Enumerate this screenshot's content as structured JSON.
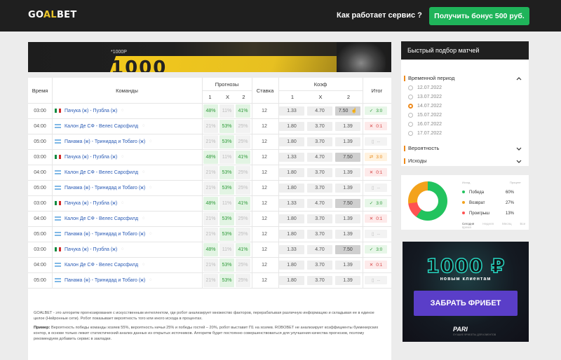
{
  "header": {
    "logo_prefix": "GO",
    "logo_accent": "AL",
    "logo_suffix": "BET",
    "how_it_works": "Как работает сервис ?",
    "bonus_button": "Получить бонус 500 руб."
  },
  "banner": {
    "small_text": "*1000Р",
    "big_text": "1000"
  },
  "table": {
    "headers": {
      "time": "Время",
      "teams": "Команды",
      "forecasts": "Прогнозы",
      "stake": "Ставка",
      "coef": "Коэф",
      "result": "Итог",
      "sub": [
        "1",
        "X",
        "2"
      ]
    },
    "rows": [
      {
        "time": "03:00",
        "flag": "mx",
        "team": "Пачука (ж) - Пузбла (ж)",
        "p1": "48%",
        "px": "11%",
        "p2": "41%",
        "hi": "p1p2",
        "stake": "12",
        "k1": "1.33",
        "kx": "4.70",
        "k2": "7.50",
        "sel": "k2",
        "res": "3:0",
        "res_type": "ok",
        "res_icon": "✓"
      },
      {
        "time": "04:00",
        "flag": "ar",
        "team": "Калон Де СФ - Велес Сарсфилд",
        "p1": "21%",
        "px": "53%",
        "p2": "25%",
        "hi": "px",
        "stake": "12",
        "k1": "1.80",
        "kx": "3.70",
        "k2": "1.39",
        "sel": "",
        "res": "0:1",
        "res_type": "bad",
        "res_icon": "✕"
      },
      {
        "time": "05:00",
        "flag": "ar",
        "team": "Панама (ж) - Тринидад и Тобаго (ж)",
        "p1": "21%",
        "px": "53%",
        "p2": "25%",
        "hi": "px",
        "stake": "12",
        "k1": "1.80",
        "kx": "3.70",
        "k2": "1.39",
        "sel": "",
        "res": "--",
        "res_type": "none",
        "res_icon": "▯"
      },
      {
        "time": "03:00",
        "flag": "mx",
        "team": "Пачука (ж) - Пузбла (ж)",
        "p1": "48%",
        "px": "11%",
        "p2": "41%",
        "hi": "p1p2",
        "stake": "12",
        "k1": "1.33",
        "kx": "4.70",
        "k2": "7.50",
        "sel": "k2",
        "res": "3:0",
        "res_type": "ret",
        "res_icon": "⇄"
      },
      {
        "time": "04:00",
        "flag": "ar",
        "team": "Калон Де СФ - Велес Сарсфилд",
        "p1": "21%",
        "px": "53%",
        "p2": "25%",
        "hi": "px",
        "stake": "12",
        "k1": "1.80",
        "kx": "3.70",
        "k2": "1.39",
        "sel": "",
        "res": "0:1",
        "res_type": "bad",
        "res_icon": "✕"
      },
      {
        "time": "05:00",
        "flag": "ar",
        "team": "Панама (ж) - Тринидад и Тобаго (ж)",
        "p1": "21%",
        "px": "53%",
        "p2": "25%",
        "hi": "px",
        "stake": "12",
        "k1": "1.80",
        "kx": "3.70",
        "k2": "1.39",
        "sel": "",
        "res": "--",
        "res_type": "none",
        "res_icon": "▯"
      },
      {
        "time": "03:00",
        "flag": "mx",
        "team": "Пачука (ж) - Пузбла (ж)",
        "p1": "48%",
        "px": "11%",
        "p2": "41%",
        "hi": "p1p2",
        "stake": "12",
        "k1": "1.33",
        "kx": "4.70",
        "k2": "7.50",
        "sel": "k2",
        "res": "3:0",
        "res_type": "ok",
        "res_icon": "✓"
      },
      {
        "time": "04:00",
        "flag": "ar",
        "team": "Калон Де СФ - Велес Сарсфилд",
        "p1": "21%",
        "px": "53%",
        "p2": "25%",
        "hi": "px",
        "stake": "12",
        "k1": "1.80",
        "kx": "3.70",
        "k2": "1.39",
        "sel": "",
        "res": "0:1",
        "res_type": "bad",
        "res_icon": "✕"
      },
      {
        "time": "05:00",
        "flag": "ar",
        "team": "Панама (ж) - Тринидад и Тобаго (ж)",
        "p1": "21%",
        "px": "53%",
        "p2": "25%",
        "hi": "px",
        "stake": "12",
        "k1": "1.80",
        "kx": "3.70",
        "k2": "1.39",
        "sel": "",
        "res": "--",
        "res_type": "none",
        "res_icon": "▯"
      },
      {
        "time": "03:00",
        "flag": "mx",
        "team": "Пачука (ж) - Пузбла (ж)",
        "p1": "48%",
        "px": "11%",
        "p2": "41%",
        "hi": "p1p2",
        "stake": "12",
        "k1": "1.33",
        "kx": "4.70",
        "k2": "7.50",
        "sel": "k2",
        "res": "3:0",
        "res_type": "ok",
        "res_icon": "✓"
      },
      {
        "time": "04:00",
        "flag": "ar",
        "team": "Калон Де СФ - Велес Сарсфилд",
        "p1": "21%",
        "px": "53%",
        "p2": "25%",
        "hi": "px",
        "stake": "12",
        "k1": "1.80",
        "kx": "3.70",
        "k2": "1.39",
        "sel": "",
        "res": "0:1",
        "res_type": "bad",
        "res_icon": "✕"
      },
      {
        "time": "05:00",
        "flag": "ar",
        "team": "Панама (ж) - Тринидад и Тобаго (ж)",
        "p1": "21%",
        "px": "53%",
        "p2": "25%",
        "hi": "px",
        "stake": "12",
        "k1": "1.80",
        "kx": "3.70",
        "k2": "1.39",
        "sel": "",
        "res": "--",
        "res_type": "none",
        "res_icon": "▯"
      }
    ]
  },
  "footnote": {
    "p1": "GOALBET - это алгоритм прогнозирования с искусственным интеллектом, где робот анализирует множество факторов, перерабатывая различную информацию и складывая ее в единое целое (Нейронные сети). Робот показывает вероятность того или иного исхода в процентах.",
    "p2_bold": "Пример:",
    "p2": " Вероятность победы команды хозяев 55%, вероятность ничьи 25% и победы гостей – 20%, робот выставит П1 на хозяев. ROBOBET не анализирует коэффициенты букмекерских контор, в основе только лежит статистический анализ данных из открытых источников. Алгоритм будет постоянно совершенствоваться для улучшения качества прогнозов, поэтому рекомендуем добавить сервис в закладки."
  },
  "filter": {
    "title": "Быстрый подбор матчей",
    "period_label": "Временной период",
    "dates": [
      "12.07.2022",
      "13.07.2022",
      "14.07.2022",
      "15.07.2022",
      "16.07.2022",
      "17.07.2022"
    ],
    "selected_date_index": 2,
    "probability_label": "Вероятность",
    "outcomes_label": "Исходы"
  },
  "stats": {
    "col_left": "Исход",
    "col_right": "Процент",
    "items": [
      {
        "label": "Победа",
        "value": "60%",
        "color": "#22c35e"
      },
      {
        "label": "Возврат",
        "value": "27%",
        "color": "#f3a21b"
      },
      {
        "label": "Проигрыш",
        "value": "13%",
        "color": "#ff5252"
      }
    ],
    "periods": [
      "Сегодня",
      "Неделя",
      "Месяц",
      "Все время"
    ]
  },
  "promo": {
    "amount": "1000 ₽",
    "subtitle": "новым клиентам",
    "button": "ЗАБРАТЬ ФРИБЕТ",
    "brand": "PARI",
    "brand_sub": "ЛУЧШИЕ ФРИБЕТЫ ДЛЯ КЛИЕНТОВ"
  },
  "colors": {
    "accent_green": "#1fb45a",
    "accent_orange": "#ee8a1c",
    "header_bg": "#1f1f1f"
  }
}
